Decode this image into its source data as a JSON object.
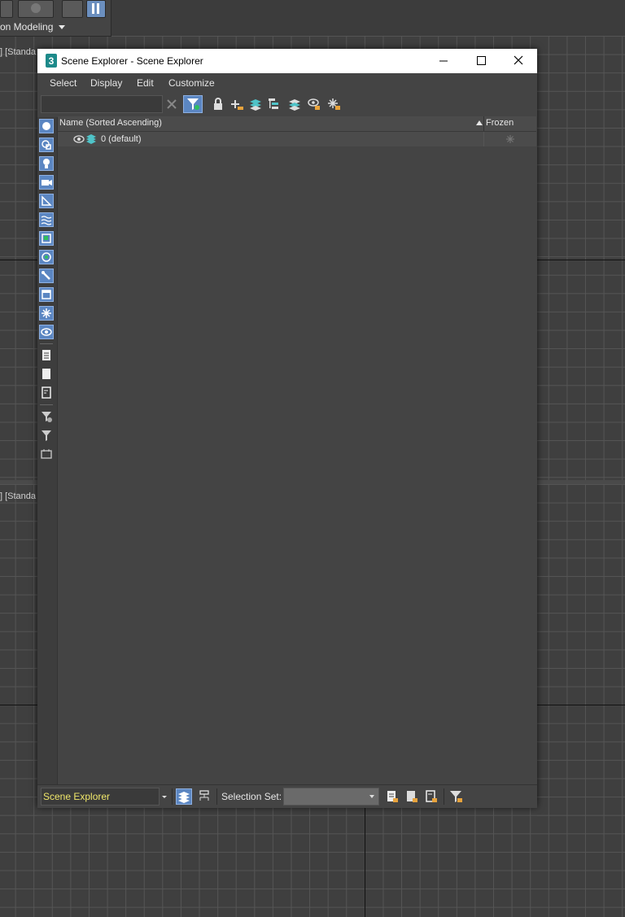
{
  "ribbon": {
    "label": "on Modeling"
  },
  "viewports": {
    "top_label": "] [Standa",
    "bottom_label": "] [Standa"
  },
  "window": {
    "title": "Scene Explorer - Scene Explorer",
    "menu": [
      "Select",
      "Display",
      "Edit",
      "Customize"
    ]
  },
  "list": {
    "col_name": "Name (Sorted Ascending)",
    "col_frozen": "Frozen",
    "rows": [
      {
        "name": "0 (default)"
      }
    ]
  },
  "statusbar": {
    "explorer_name": "Scene Explorer",
    "selection_set_label": "Selection Set:",
    "selection_set_value": ""
  },
  "colors": {
    "accent": "#5b86c2",
    "highlight_text": "#f0e76a",
    "layer_icon": "#4fc3c8"
  }
}
